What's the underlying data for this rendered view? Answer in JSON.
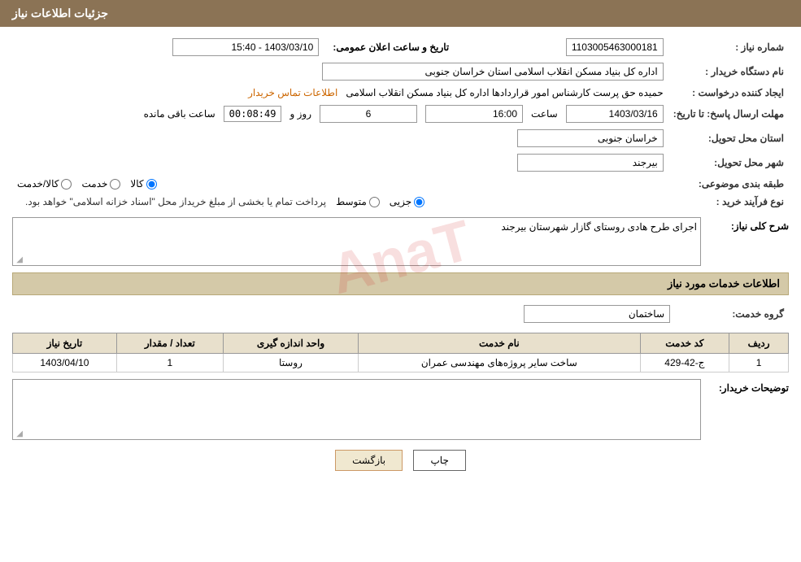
{
  "header": {
    "title": "جزئیات اطلاعات نیاز"
  },
  "section1": {
    "title": "جزئیات اطلاعات نیاز"
  },
  "fields": {
    "shmare_niaz_label": "شماره نیاز :",
    "shmare_niaz_value": "1103005463000181",
    "name_dastgah_label": "نام دستگاه خریدار :",
    "name_dastgah_value": "اداره کل بنیاد مسکن انقلاب اسلامی استان خراسان جنوبی",
    "ijad_label": "ایجاد کننده درخواست :",
    "ijad_value": "حمیده حق پرست کارشناس امور قراردادها اداره کل بنیاد مسکن انقلاب اسلامی",
    "etelaaat_link": "اطلاعات تماس خریدار",
    "mohlet_label": "مهلت ارسال پاسخ: تا تاریخ:",
    "date_value": "1403/03/16",
    "saat_label": "ساعت",
    "saat_value": "16:00",
    "rooz_label": "روز و",
    "rooz_value": "6",
    "baqi_label": "ساعت باقی مانده",
    "baqi_value": "00:08:49",
    "tarikh_announce_label": "تاریخ و ساعت اعلان عمومی:",
    "tarikh_announce_value": "1403/03/10 - 15:40",
    "ostan_label": "استان محل تحویل:",
    "ostan_value": "خراسان جنوبی",
    "shahr_label": "شهر محل تحویل:",
    "shahr_value": "بیرجند",
    "tabaqe_label": "طبقه بندی موضوعی:",
    "tabaqe_kala": "کالا",
    "tabaqe_khedmat": "خدمت",
    "tabaqe_kala_khedmat": "کالا/خدمت",
    "nooe_farayand_label": "نوع فرآیند خرید :",
    "nooe_jozyi": "جزیی",
    "nooe_motevaset": "متوسط",
    "nooe_desc": "پرداخت تمام یا بخشی از مبلغ خریداز محل \"اسناد خزانه اسلامی\" خواهد بود.",
    "sharh_label": "شرح کلی نیاز:",
    "sharh_value": "اجرای طرح هادی روستای گازار شهرستان بیرجند"
  },
  "section2": {
    "title": "اطلاعات خدمات مورد نیاز"
  },
  "grooh_khedmat_label": "گروه خدمت:",
  "grooh_khedmat_value": "ساختمان",
  "table": {
    "headers": [
      "ردیف",
      "کد خدمت",
      "نام خدمت",
      "واحد اندازه گیری",
      "تعداد / مقدار",
      "تاریخ نیاز"
    ],
    "rows": [
      {
        "radif": "1",
        "code": "ج-42-429",
        "name": "ساخت سایر پروژه‌های مهندسی عمران",
        "vahed": "روستا",
        "tedad": "1",
        "tarikh": "1403/04/10"
      }
    ]
  },
  "tosif_label": "توضیحات خریدار:",
  "buttons": {
    "chap": "چاپ",
    "bazgasht": "بازگشت"
  }
}
